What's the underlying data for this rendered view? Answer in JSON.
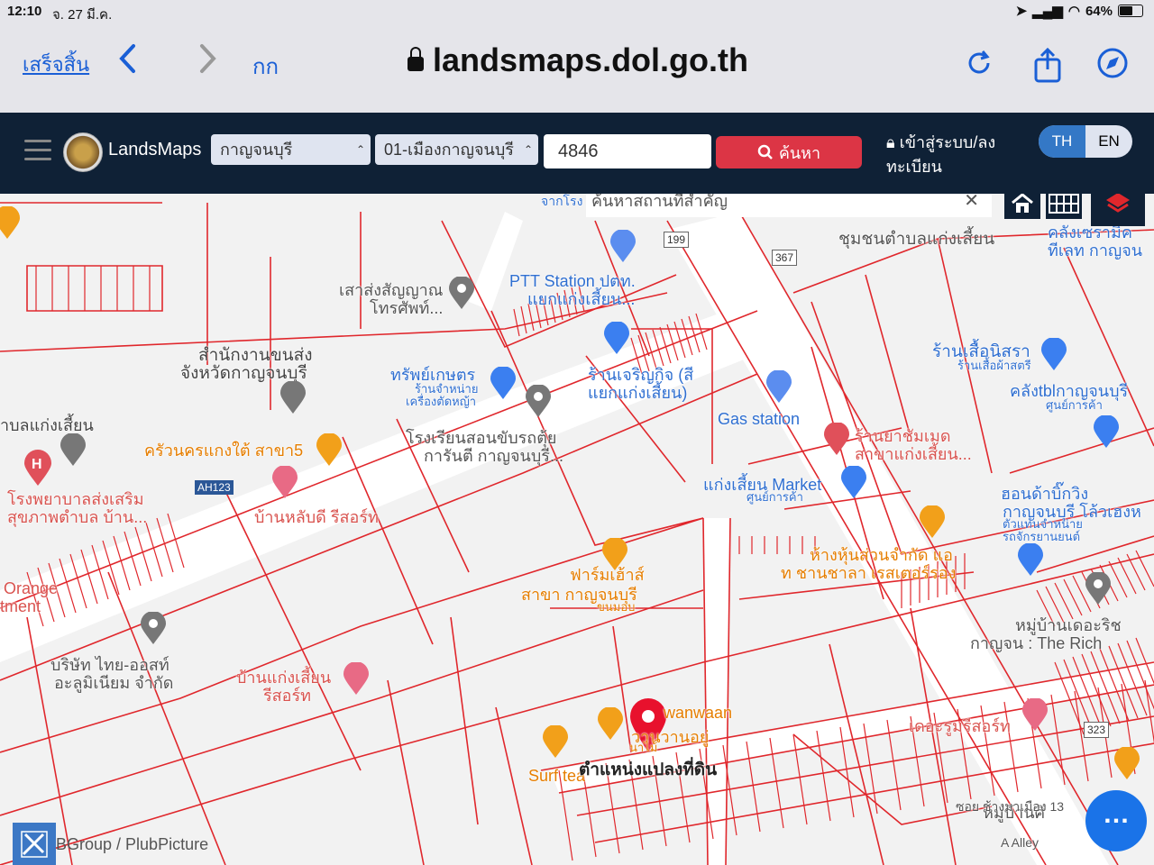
{
  "status_bar": {
    "time": "12:10",
    "date": "จ. 27 มี.ค.",
    "battery": "64%"
  },
  "browser": {
    "done_label": "เสร็จสิ้น",
    "text_size_label": "กก",
    "url": "landsmaps.dol.go.th",
    "back_icon": "chevron-left-icon",
    "forward_icon": "chevron-right-icon",
    "reload_icon": "reload-icon",
    "share_icon": "share-icon",
    "compass_icon": "compass-icon"
  },
  "app": {
    "brand": "LandsMaps",
    "province_select": "กาญจนบุรี",
    "district_select": "01-เมืองกาญจนบุรี",
    "parcel_input": "4846",
    "search_label": "ค้นหา",
    "login_label": "เข้าสู่ระบบ/ลงทะเบียน",
    "lang_th": "TH",
    "lang_en": "EN",
    "accent": "#dc3545",
    "nav_bg": "#0f2136"
  },
  "map": {
    "place_search_placeholder": "ค้นหาสถานที่สำคัญ",
    "attribution": "BGroup / PlubPicture",
    "parcel_line_color": "#e0272c",
    "selected_parcel_label": "ตำแหน่งแปลงที่ดิน",
    "road_shields": [
      "199",
      "367",
      "AH123",
      "323"
    ],
    "labels": [
      {
        "text": "จากโรง",
        "color": "#2f6fd1"
      },
      {
        "text": "ชุมชนตำบลแก่งเสี้ยน",
        "color": "#555"
      },
      {
        "text": "คลังเซรามิค",
        "color": "#2f6fd1"
      },
      {
        "text": "ทีเลท กาญจน",
        "color": "#2f6fd1"
      },
      {
        "text": "PTT Station ปตท.",
        "color": "#2f6fd1"
      },
      {
        "text": "แยกแก่งเสี้ยน...",
        "color": "#2f6fd1"
      },
      {
        "text": "เสาส่งสัญญาณ",
        "color": "#555"
      },
      {
        "text": "โทรศัพท์...",
        "color": "#555"
      },
      {
        "text": "สำนักงานขนส่ง",
        "color": "#444"
      },
      {
        "text": "จังหวัดกาญจนบุรี",
        "color": "#444"
      },
      {
        "text": "ทรัพย์เกษตร",
        "color": "#2f6fd1"
      },
      {
        "text": "ร้านจำหน่าย",
        "color": "#2f6fd1"
      },
      {
        "text": "เครื่องตัดหญ้า",
        "color": "#2f6fd1"
      },
      {
        "text": "ร้านเจริญกิจ (สี",
        "color": "#2f6fd1"
      },
      {
        "text": "แยกแก่งเสี้ยน)",
        "color": "#2f6fd1"
      },
      {
        "text": "ร้านเสื้อนิสรา",
        "color": "#2f6fd1"
      },
      {
        "text": "ร้านเสื้อผ้าสตรี",
        "color": "#2f6fd1"
      },
      {
        "text": "คลังtblกาญจนบุรี",
        "color": "#2f6fd1"
      },
      {
        "text": "ศูนย์การค้า",
        "color": "#2f6fd1"
      },
      {
        "text": "าบลแก่งเสี้ยน",
        "color": "#444"
      },
      {
        "text": "ครัวนครแกงใต้ สาขา5",
        "color": "#e67e00"
      },
      {
        "text": "โรงเรียนสอนขับรถตุ้ย",
        "color": "#555"
      },
      {
        "text": "การันตี กาญจนบุรี...",
        "color": "#555"
      },
      {
        "text": "Gas station",
        "color": "#2f6fd1"
      },
      {
        "text": "ร้านยาชัมเมด",
        "color": "#d9534f"
      },
      {
        "text": "สาขาแก่งเสี้ยน...",
        "color": "#d9534f"
      },
      {
        "text": "โรงพยาบาลส่งเสริม",
        "color": "#d9534f"
      },
      {
        "text": "สุขภาพตำบล บ้าน...",
        "color": "#d9534f"
      },
      {
        "text": "บ้านหลับดี รีสอร์ท",
        "color": "#d9534f"
      },
      {
        "text": "แก่งเสี้ยน Market",
        "color": "#2f6fd1"
      },
      {
        "text": "ศูนย์การค้า",
        "color": "#2f6fd1"
      },
      {
        "text": "ฮอนด้าบิ๊กวิง",
        "color": "#2f6fd1"
      },
      {
        "text": "กาญจนบุรี โล้วเฮงห",
        "color": "#2f6fd1"
      },
      {
        "text": "ตัวแทนจำหน่าย",
        "color": "#2f6fd1"
      },
      {
        "text": "รถจักรยานยนต์",
        "color": "#2f6fd1"
      },
      {
        "text": "ห้างหุ้นส่วนจำกัด แอ",
        "color": "#e67e00"
      },
      {
        "text": "ท ชานชาลา เรสเตอร์รอง",
        "color": "#e67e00"
      },
      {
        "text": "ฟาร์มเฮ้าส์",
        "color": "#e67e00"
      },
      {
        "text": "สาขา กาญจนบุรี",
        "color": "#e67e00"
      },
      {
        "text": "ขนมอบ",
        "color": "#e67e00"
      },
      {
        "text": "Orange",
        "color": "#d9534f"
      },
      {
        "text": "tment",
        "color": "#d9534f"
      },
      {
        "text": "บริษัท ไทย-ออสท์",
        "color": "#555"
      },
      {
        "text": "อะลูมิเนียม จำกัด",
        "color": "#555"
      },
      {
        "text": "หมู่บ้านเดอะริช",
        "color": "#555"
      },
      {
        "text": "กาญจน : The Rich",
        "color": "#555"
      },
      {
        "text": "บ้านแก่งเสี้ยน",
        "color": "#d9534f"
      },
      {
        "text": "รีสอร์ท",
        "color": "#d9534f"
      },
      {
        "text": "wanwaan",
        "color": "#e67e00"
      },
      {
        "text": "วานวานอยู่",
        "color": "#e67e00"
      },
      {
        "text": "นาไม้",
        "color": "#e67e00"
      },
      {
        "text": "Surf tea",
        "color": "#e67e00"
      },
      {
        "text": "เดอะรูมรีสอร์ท",
        "color": "#d9534f"
      },
      {
        "text": "หมู่บ้านศิ",
        "color": "#555"
      },
      {
        "text": "ซอย ช้างมาเมือง 13",
        "color": "#555"
      },
      {
        "text": "A Alley",
        "color": "#555"
      }
    ]
  }
}
